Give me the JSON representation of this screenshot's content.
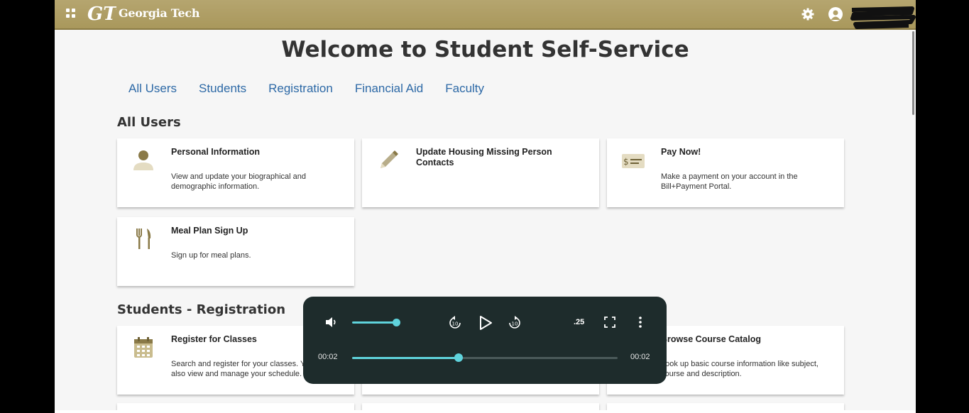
{
  "header": {
    "brand": "Georgia Tech",
    "logo_text": "GT",
    "bg_color": "#b2a16a"
  },
  "page": {
    "title": "Welcome to Student Self-Service"
  },
  "tabs": [
    "All Users",
    "Students",
    "Registration",
    "Financial Aid",
    "Faculty"
  ],
  "sections": {
    "all_users": {
      "heading": "All Users",
      "cards": [
        {
          "title": "Personal Information",
          "desc": "View and update your biographical and demographic information.",
          "icon": "person-icon"
        },
        {
          "title": "Update Housing Missing Person Contacts",
          "desc": "",
          "icon": "pencil-icon"
        },
        {
          "title": "Pay Now!",
          "desc": "Make a payment on your account in the Bill+Payment Portal.",
          "icon": "payment-icon"
        },
        {
          "title": "Meal Plan Sign Up",
          "desc": "Sign up for meal plans.",
          "icon": "utensils-icon"
        }
      ]
    },
    "students_registration": {
      "heading": "Students - Registration",
      "cards": [
        {
          "title": "Register for Classes",
          "desc": "Search and register for your classes. You can also view and manage your schedule.",
          "icon": "calendar-icon"
        },
        {
          "title": "",
          "desc": "",
          "icon": ""
        },
        {
          "title": "Browse Course Catalog",
          "desc": "Look up basic course information like subject, course and description.",
          "icon": "book-icon"
        }
      ]
    }
  },
  "player": {
    "current_time": "00:02",
    "duration": "00:02",
    "speed": ".25",
    "volume": 1.0,
    "progress": 0.4,
    "accent": "#5fd3dc"
  }
}
